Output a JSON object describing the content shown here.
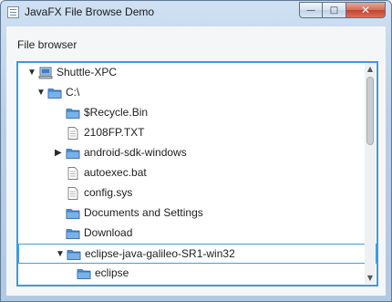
{
  "window": {
    "title": "JavaFX File Browse Demo",
    "controls": {
      "minimize": "—",
      "maximize": "□",
      "close": "✕"
    }
  },
  "browser": {
    "label": "File browser"
  },
  "tree": {
    "items": [
      {
        "label": "Shuttle-XPC",
        "icon": "computer-icon",
        "disclosure": "expanded",
        "level": 0
      },
      {
        "label": "C:\\",
        "icon": "folder-icon",
        "disclosure": "expanded",
        "level": 1
      },
      {
        "label": "$Recycle.Bin",
        "icon": "folder-icon",
        "disclosure": "none",
        "level": 2
      },
      {
        "label": "2108FP.TXT",
        "icon": "file-icon",
        "disclosure": "none",
        "level": 2
      },
      {
        "label": "android-sdk-windows",
        "icon": "folder-icon",
        "disclosure": "collapsed",
        "level": 2
      },
      {
        "label": "autoexec.bat",
        "icon": "file-icon",
        "disclosure": "none",
        "level": 2
      },
      {
        "label": "config.sys",
        "icon": "file-icon",
        "disclosure": "none",
        "level": 2
      },
      {
        "label": "Documents and Settings",
        "icon": "folder-icon",
        "disclosure": "none",
        "level": 2
      },
      {
        "label": "Download",
        "icon": "folder-icon",
        "disclosure": "none",
        "level": 2
      },
      {
        "label": "eclipse-java-galileo-SR1-win32",
        "icon": "folder-icon",
        "disclosure": "expanded",
        "level": 2,
        "selected": true
      },
      {
        "label": "eclipse",
        "icon": "folder-icon",
        "disclosure": "none",
        "level": 3
      }
    ]
  },
  "scrollbar": {
    "up": "▲",
    "down": "▼"
  },
  "colors": {
    "focus": "#3c9be0",
    "folder": "#4f8fd6",
    "titlebar": "#c4d7ec"
  }
}
